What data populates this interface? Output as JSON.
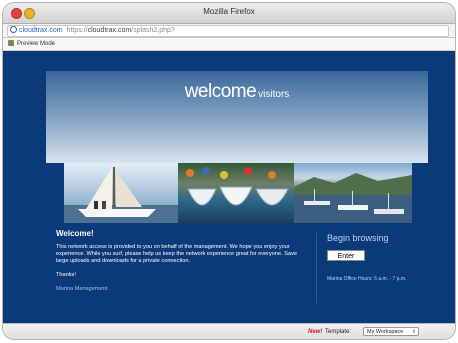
{
  "window": {
    "title": "Mozilla Firefox"
  },
  "urlbar": {
    "domain": "cloudtrax.com",
    "scheme": "https://",
    "host": "cloudtrax.com",
    "path": "/splash2.php?"
  },
  "preview": {
    "label": "Preview Mode"
  },
  "hero": {
    "title_big": "welcome",
    "title_small": "visitors"
  },
  "content": {
    "heading": "Welcome!",
    "paragraph": "This network access is provided to you on behalf of the management. We hope you enjoy your experience. While you surf, please help us keep the network experience great for everyone. Save large uploads and downloads for a private connection.",
    "thanks": "Thanks!",
    "signature": "Marina Management"
  },
  "sidebar": {
    "begin_label": "Begin browsing",
    "enter_label": "Enter",
    "hours": "Marina Office Hours: 6 a.m. - 7 p.m."
  },
  "bottombar": {
    "new_label": "New!",
    "template_label": "Template:",
    "template_value": "My Workspace"
  },
  "colors": {
    "page_bg": "#0b3a7a",
    "link": "#2a62b8",
    "new": "#d01010"
  }
}
